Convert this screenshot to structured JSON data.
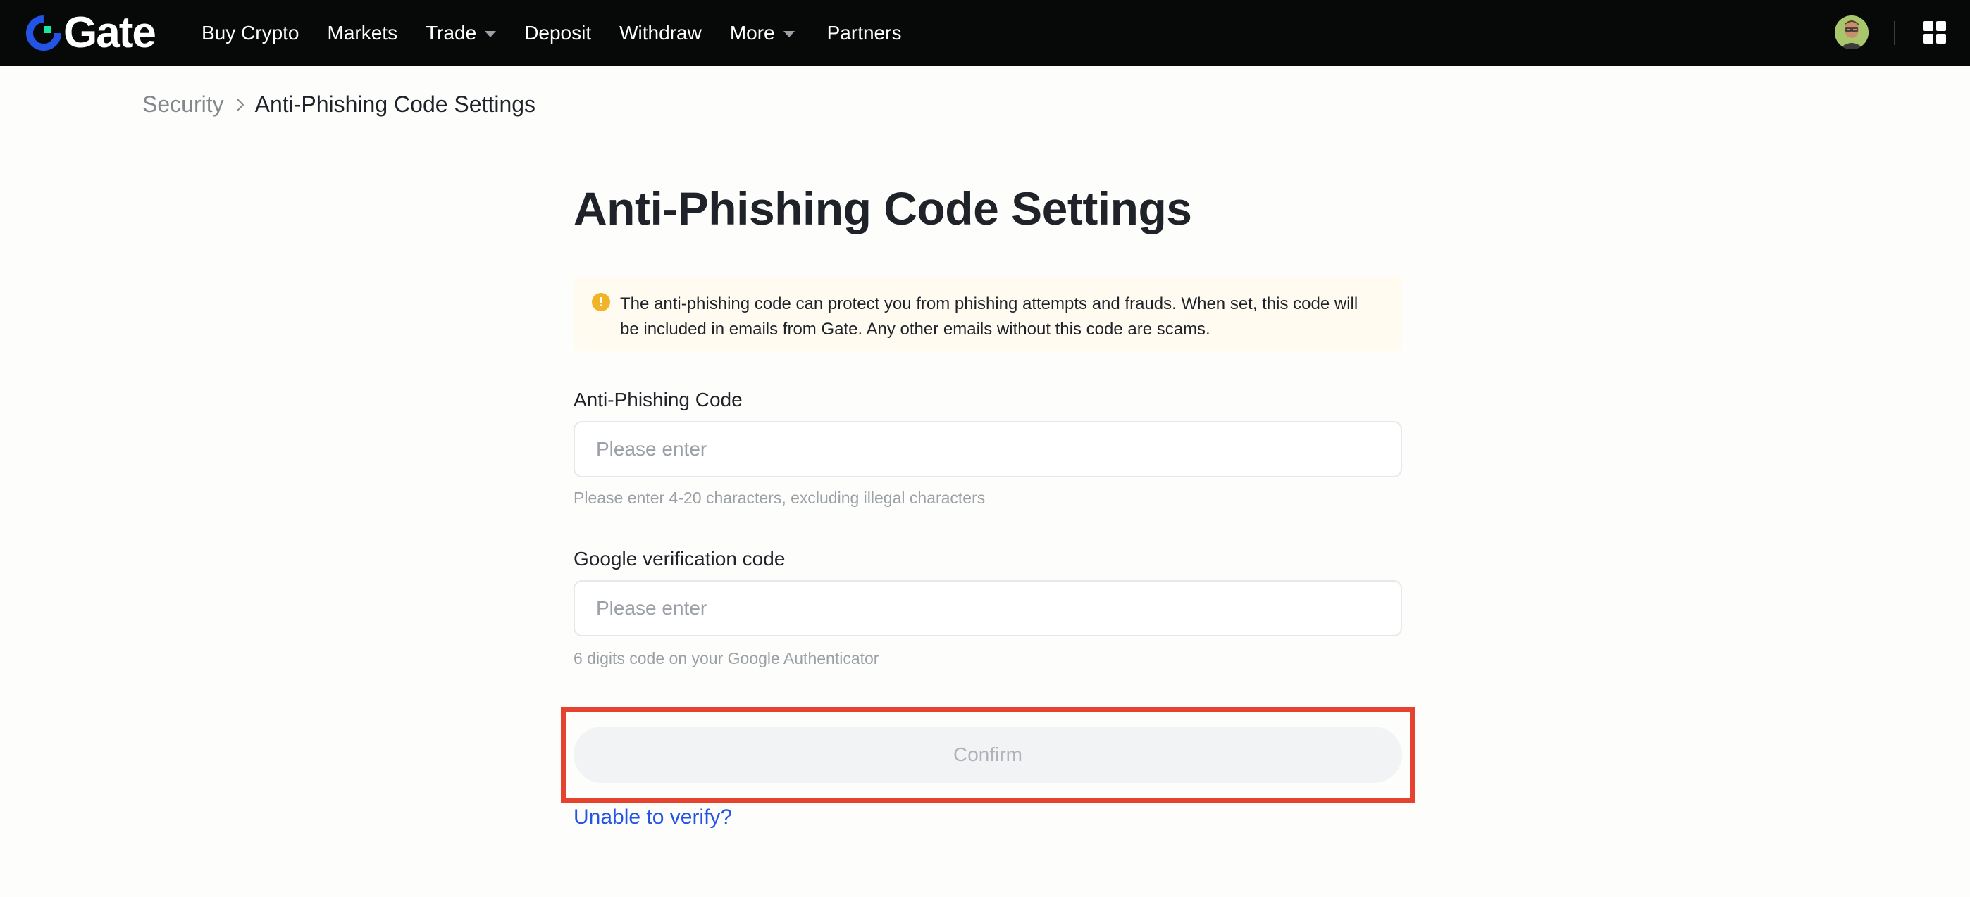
{
  "header": {
    "logo_text": "Gate",
    "nav": [
      {
        "label": "Buy Crypto",
        "has_dropdown": false
      },
      {
        "label": "Markets",
        "has_dropdown": false
      },
      {
        "label": "Trade",
        "has_dropdown": true
      },
      {
        "label": "Deposit",
        "has_dropdown": false
      },
      {
        "label": "Withdraw",
        "has_dropdown": false
      },
      {
        "label": "More",
        "has_dropdown": true
      },
      {
        "label": "Partners",
        "has_dropdown": false
      }
    ],
    "icons": [
      "avatar",
      "apps-grid-icon"
    ]
  },
  "breadcrumb": {
    "parent": "Security",
    "current": "Anti-Phishing Code Settings"
  },
  "page": {
    "title": "Anti-Phishing Code Settings",
    "notice": "The anti-phishing code can protect you from phishing attempts and frauds. When set, this code will be included in emails from Gate. Any other emails without this code are scams.",
    "notice_icon": "warning-icon"
  },
  "form": {
    "anti_phishing": {
      "label": "Anti-Phishing Code",
      "value": "",
      "placeholder": "Please enter",
      "hint": "Please enter 4-20 characters, excluding illegal characters"
    },
    "google_code": {
      "label": "Google verification code",
      "value": "",
      "placeholder": "Please enter",
      "hint": "6 digits code on your Google Authenticator"
    },
    "confirm_label": "Confirm",
    "unable_link": "Unable to verify?"
  },
  "colors": {
    "topbar": "#070808",
    "accent_link": "#2354e6",
    "highlight_border": "#e5432f",
    "notice_bg": "#fffbf0",
    "warning": "#f0b429",
    "logo_blue": "#2354e6",
    "logo_green": "#17e7a3"
  }
}
